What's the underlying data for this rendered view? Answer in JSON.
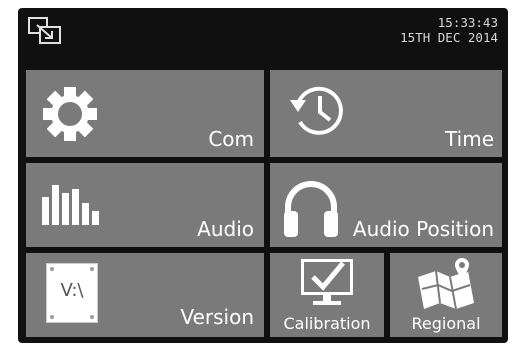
{
  "header": {
    "time": "15:33:43",
    "date": "15TH DEC 2014",
    "icon": "screen-switch-icon"
  },
  "tiles": {
    "com": {
      "label": "Com",
      "icon": "gear-icon"
    },
    "time": {
      "label": "Time",
      "icon": "clock-history-icon"
    },
    "audio": {
      "label": "Audio",
      "icon": "equalizer-bars-icon"
    },
    "audio_position": {
      "label": "Audio Position",
      "icon": "headphones-icon"
    },
    "version": {
      "label": "Version",
      "icon": "version-plate-icon",
      "icon_text": "V:\\"
    },
    "calibration": {
      "label": "Calibration",
      "icon": "monitor-check-icon"
    },
    "regional": {
      "label": "Regional",
      "icon": "map-pin-icon"
    }
  },
  "colors": {
    "background": "#101010",
    "tile": "#7a7a7a",
    "text": "#ffffff",
    "clock": "#d8d8d8"
  }
}
